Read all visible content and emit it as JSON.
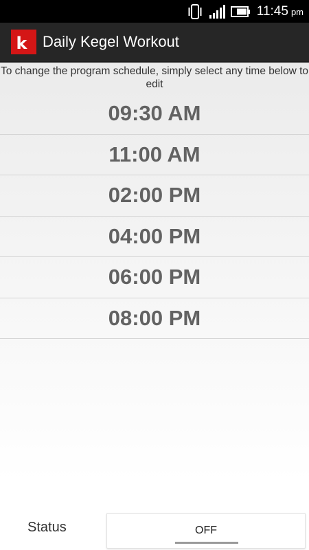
{
  "status_bar": {
    "time": "11:45",
    "ampm": "pm",
    "icons": [
      "vibrate-icon",
      "signal-icon",
      "battery-icon"
    ]
  },
  "app_bar": {
    "logo_letter": "k",
    "title": "Daily Kegel Workout",
    "logo_color": "#d41616"
  },
  "instructions": "To change the program schedule, simply select any time below to edit",
  "schedule": {
    "times": [
      "09:30 AM",
      "11:00 AM",
      "02:00 PM",
      "04:00 PM",
      "06:00 PM",
      "08:00 PM"
    ]
  },
  "status": {
    "label": "Status",
    "toggle_value": "OFF"
  }
}
